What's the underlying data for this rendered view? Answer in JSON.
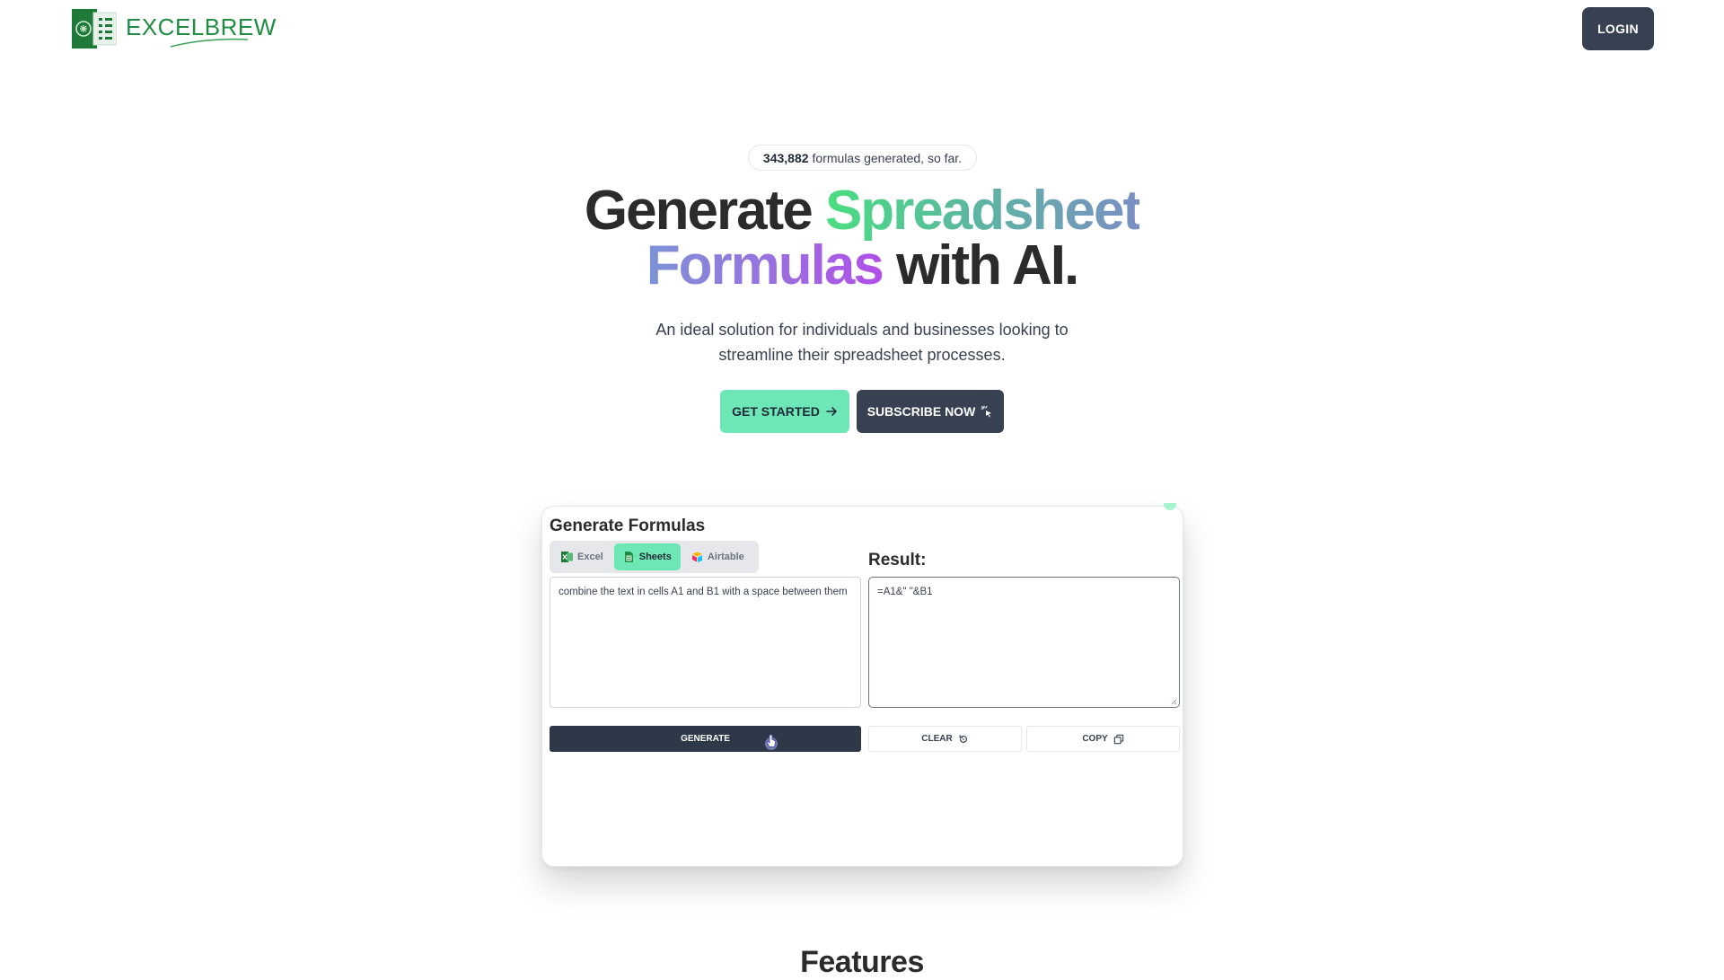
{
  "header": {
    "brand_name": "EXCELBREW",
    "login_label": "LOGIN"
  },
  "hero": {
    "counter_value": "343,882",
    "counter_text": "formulas generated, so far.",
    "title_word_1": "Generate",
    "title_word_2": "Spreadsheet",
    "title_word_3": "Formulas",
    "title_word_4": "with AI.",
    "subtitle_line_1": "An ideal solution for individuals and businesses looking to",
    "subtitle_line_2": "streamline their spreadsheet processes.",
    "get_started_label": "GET STARTED",
    "subscribe_label": "SUBSCRIBE NOW"
  },
  "demo": {
    "title": "Generate Formulas",
    "tabs": [
      {
        "label": "Excel",
        "active": false,
        "icon": "excel-icon"
      },
      {
        "label": "Sheets",
        "active": true,
        "icon": "sheets-icon"
      },
      {
        "label": "Airtable",
        "active": false,
        "icon": "airtable-icon"
      }
    ],
    "result_label": "Result:",
    "prompt_value": "combine the text in cells A1 and B1 with a space between them",
    "result_value": "=A1&\" \"&B1",
    "generate_label": "GENERATE",
    "clear_label": "CLEAR",
    "copy_label": "COPY"
  },
  "features": {
    "heading": "Features"
  },
  "colors": {
    "brand_green": "#1f8e43",
    "accent_mint": "#6ee7b7",
    "dark_button": "#374151",
    "gradient_green": "#4ade80",
    "gradient_purple": "#b14fe8"
  }
}
